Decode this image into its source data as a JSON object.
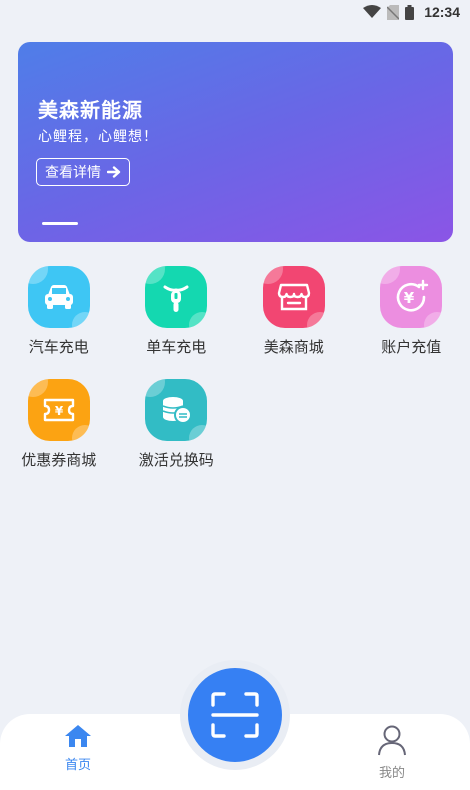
{
  "status_bar": {
    "time": "12:34"
  },
  "banner": {
    "title": "美森新能源",
    "subtitle": "心鲤程，心鲤想！",
    "button_label": "查看详情"
  },
  "grid": {
    "items": [
      {
        "label": "汽车充电",
        "icon": "car-icon",
        "color": "#3ec6f4"
      },
      {
        "label": "单车充电",
        "icon": "scooter-icon",
        "color": "#14d8b0"
      },
      {
        "label": "美森商城",
        "icon": "store-icon",
        "color": "#f24672"
      },
      {
        "label": "账户充值",
        "icon": "yuan-coin-icon",
        "color": "#ec8ee0"
      },
      {
        "label": "优惠券商城",
        "icon": "coupon-icon",
        "color": "#fca312"
      },
      {
        "label": "激活兑换码",
        "icon": "coin-stack-icon",
        "color": "#32bcc5"
      }
    ]
  },
  "tabbar": {
    "home_label": "首页",
    "mine_label": "我的",
    "active_color": "#3b87f0",
    "inactive_color": "#888888"
  },
  "scan_button": {
    "icon": "scan-icon",
    "color": "#3680f3"
  }
}
